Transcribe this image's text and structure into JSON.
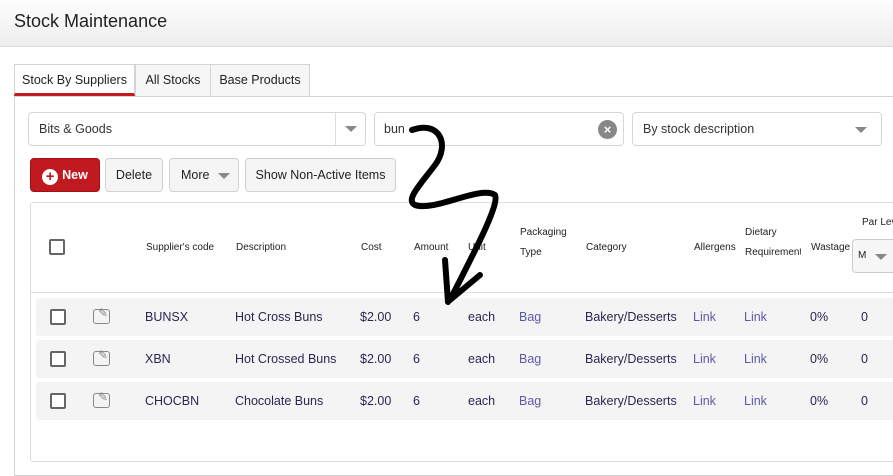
{
  "page": {
    "title": "Stock Maintenance"
  },
  "tabs": [
    {
      "label": "Stock By Suppliers",
      "active": true
    },
    {
      "label": "All Stocks"
    },
    {
      "label": "Base Products"
    }
  ],
  "filters": {
    "supplier": "Bits & Goods",
    "search_value": "bun",
    "sort": "By stock description"
  },
  "toolbar": {
    "new": "New",
    "delete": "Delete",
    "more": "More",
    "show_non_active": "Show Non-Active Items"
  },
  "table": {
    "headers": {
      "code": "Supplier's code",
      "description": "Description",
      "cost": "Cost",
      "amount": "Amount",
      "unit": "Unit",
      "packaging": "Packaging",
      "packaging2": "Type",
      "category": "Category",
      "allergens": "Allergens",
      "dietary": "Dietary",
      "dietary2": "Requirements",
      "wastage": "Wastage",
      "par": "Par Level",
      "par_select": "M"
    },
    "rows": [
      {
        "code": "BUNSX",
        "description": "Hot Cross Buns",
        "cost": "$2.00",
        "amount": "6",
        "unit": "each",
        "packaging": "Bag",
        "category": "Bakery/Desserts",
        "allergens": "Link",
        "dietary": "Link",
        "wastage": "0%",
        "par": "0"
      },
      {
        "code": "XBN",
        "description": "Hot Crossed Buns",
        "cost": "$2.00",
        "amount": "6",
        "unit": "each",
        "packaging": "Bag",
        "category": "Bakery/Desserts",
        "allergens": "Link",
        "dietary": "Link",
        "wastage": "0%",
        "par": "0"
      },
      {
        "code": "CHOCBN",
        "description": "Chocolate Buns",
        "cost": "$2.00",
        "amount": "6",
        "unit": "each",
        "packaging": "Bag",
        "category": "Bakery/Desserts",
        "allergens": "Link",
        "dietary": "Link",
        "wastage": "0%",
        "par": "0"
      }
    ]
  },
  "colors": {
    "accent": "#c0191f",
    "link": "#5c5aa8"
  }
}
